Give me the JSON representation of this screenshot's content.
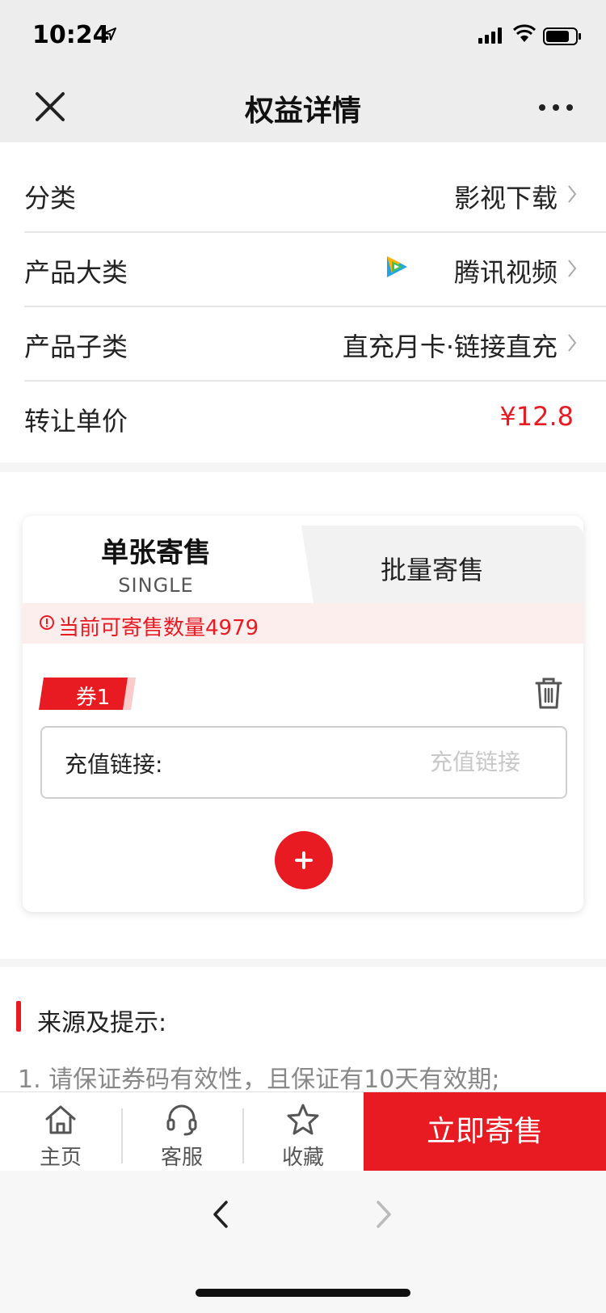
{
  "status": {
    "time": "10:24"
  },
  "nav": {
    "title": "权益详情"
  },
  "info": {
    "category": {
      "label": "分类",
      "value": "影视下载"
    },
    "product_type": {
      "label": "产品大类",
      "value": "腾讯视频"
    },
    "product_subtype": {
      "label": "产品子类",
      "value": "直充月卡·链接直充"
    },
    "unit_price": {
      "label": "转让单价",
      "value": "¥12.8"
    }
  },
  "tabs": {
    "single": {
      "label": "单张寄售",
      "sublabel": "SINGLE"
    },
    "batch": {
      "label": "批量寄售"
    }
  },
  "notice": {
    "text": "当前可寄售数量4979"
  },
  "coupon": {
    "tag": "券1",
    "link_label": "充值链接:",
    "link_placeholder": "充值链接"
  },
  "tips": {
    "title": "来源及提示:",
    "items": [
      "1. 请保证券码有效性，且保证有10天有效期;"
    ]
  },
  "actions": {
    "home": "主页",
    "service": "客服",
    "favorite": "收藏",
    "consign": "立即寄售"
  },
  "colors": {
    "accent": "#e81b23",
    "notice_bg": "#fdeeee"
  }
}
